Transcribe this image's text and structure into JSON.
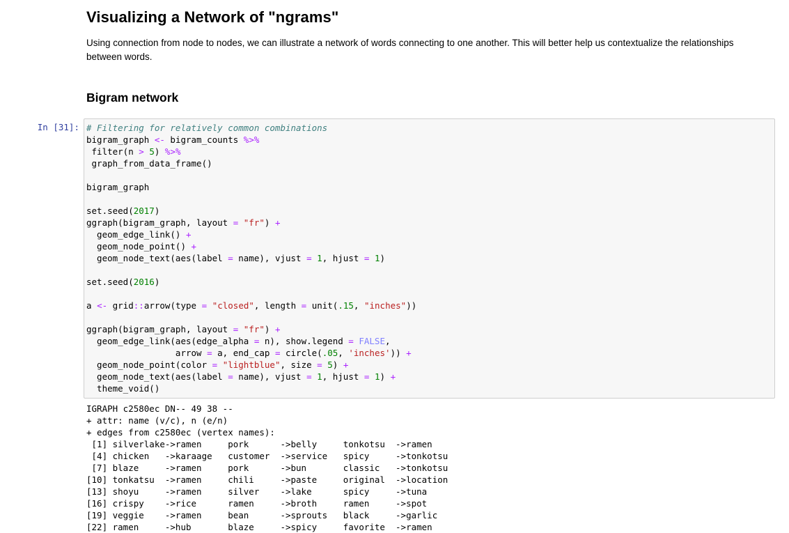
{
  "markdown": {
    "title": "Visualizing a Network of \"ngrams\"",
    "intro": "Using connection from node to nodes, we can illustrate a network of words connecting to one another. This will better help us contextualize the relationships between words.",
    "subtitle": "Bigram network"
  },
  "cell": {
    "prompt": "In [31]:",
    "code": [
      [
        [
          "cm",
          "# Filtering for relatively common combinations"
        ]
      ],
      [
        [
          "t",
          "bigram_graph "
        ],
        [
          "op",
          "<-"
        ],
        [
          "t",
          " bigram_counts "
        ],
        [
          "op",
          "%>%"
        ]
      ],
      [
        [
          "t",
          " filter(n "
        ],
        [
          "op",
          ">"
        ],
        [
          "t",
          " "
        ],
        [
          "nm",
          "5"
        ],
        [
          "t",
          ") "
        ],
        [
          "op",
          "%>%"
        ]
      ],
      [
        [
          "t",
          " graph_from_data_frame()"
        ]
      ],
      [
        [
          "t",
          ""
        ]
      ],
      [
        [
          "t",
          "bigram_graph"
        ]
      ],
      [
        [
          "t",
          ""
        ]
      ],
      [
        [
          "t",
          "set.seed("
        ],
        [
          "nm",
          "2017"
        ],
        [
          "t",
          ")"
        ]
      ],
      [
        [
          "t",
          "ggraph(bigram_graph, layout "
        ],
        [
          "op",
          "="
        ],
        [
          "t",
          " "
        ],
        [
          "st",
          "\"fr\""
        ],
        [
          "t",
          ") "
        ],
        [
          "op",
          "+"
        ]
      ],
      [
        [
          "t",
          "  geom_edge_link() "
        ],
        [
          "op",
          "+"
        ]
      ],
      [
        [
          "t",
          "  geom_node_point() "
        ],
        [
          "op",
          "+"
        ]
      ],
      [
        [
          "t",
          "  geom_node_text(aes(label "
        ],
        [
          "op",
          "="
        ],
        [
          "t",
          " name), vjust "
        ],
        [
          "op",
          "="
        ],
        [
          "t",
          " "
        ],
        [
          "nm",
          "1"
        ],
        [
          "t",
          ", hjust "
        ],
        [
          "op",
          "="
        ],
        [
          "t",
          " "
        ],
        [
          "nm",
          "1"
        ],
        [
          "t",
          ")"
        ]
      ],
      [
        [
          "t",
          ""
        ]
      ],
      [
        [
          "t",
          "set.seed("
        ],
        [
          "nm",
          "2016"
        ],
        [
          "t",
          ")"
        ]
      ],
      [
        [
          "t",
          ""
        ]
      ],
      [
        [
          "t",
          "a "
        ],
        [
          "op",
          "<-"
        ],
        [
          "t",
          " grid"
        ],
        [
          "op",
          "::"
        ],
        [
          "t",
          "arrow(type "
        ],
        [
          "op",
          "="
        ],
        [
          "t",
          " "
        ],
        [
          "st",
          "\"closed\""
        ],
        [
          "t",
          ", length "
        ],
        [
          "op",
          "="
        ],
        [
          "t",
          " unit("
        ],
        [
          "nm",
          ".15"
        ],
        [
          "t",
          ", "
        ],
        [
          "st",
          "\"inches\""
        ],
        [
          "t",
          "))"
        ]
      ],
      [
        [
          "t",
          ""
        ]
      ],
      [
        [
          "t",
          "ggraph(bigram_graph, layout "
        ],
        [
          "op",
          "="
        ],
        [
          "t",
          " "
        ],
        [
          "st",
          "\"fr\""
        ],
        [
          "t",
          ") "
        ],
        [
          "op",
          "+"
        ]
      ],
      [
        [
          "t",
          "  geom_edge_link(aes(edge_alpha "
        ],
        [
          "op",
          "="
        ],
        [
          "t",
          " n), show.legend "
        ],
        [
          "op",
          "="
        ],
        [
          "t",
          " "
        ],
        [
          "kw",
          "FALSE"
        ],
        [
          "t",
          ","
        ]
      ],
      [
        [
          "t",
          "                 arrow "
        ],
        [
          "op",
          "="
        ],
        [
          "t",
          " a, end_cap "
        ],
        [
          "op",
          "="
        ],
        [
          "t",
          " circle("
        ],
        [
          "nm",
          ".05"
        ],
        [
          "t",
          ", "
        ],
        [
          "st",
          "'inches'"
        ],
        [
          "t",
          ")) "
        ],
        [
          "op",
          "+"
        ]
      ],
      [
        [
          "t",
          "  geom_node_point(color "
        ],
        [
          "op",
          "="
        ],
        [
          "t",
          " "
        ],
        [
          "st",
          "\"lightblue\""
        ],
        [
          "t",
          ", size "
        ],
        [
          "op",
          "="
        ],
        [
          "t",
          " "
        ],
        [
          "nm",
          "5"
        ],
        [
          "t",
          ") "
        ],
        [
          "op",
          "+"
        ]
      ],
      [
        [
          "t",
          "  geom_node_text(aes(label "
        ],
        [
          "op",
          "="
        ],
        [
          "t",
          " name), vjust "
        ],
        [
          "op",
          "="
        ],
        [
          "t",
          " "
        ],
        [
          "nm",
          "1"
        ],
        [
          "t",
          ", hjust "
        ],
        [
          "op",
          "="
        ],
        [
          "t",
          " "
        ],
        [
          "nm",
          "1"
        ],
        [
          "t",
          ") "
        ],
        [
          "op",
          "+"
        ]
      ],
      [
        [
          "t",
          "  theme_void()"
        ]
      ]
    ]
  },
  "output": {
    "lines": [
      "IGRAPH c2580ec DN-- 49 38 --",
      "+ attr: name (v/c), n (e/n)",
      "+ edges from c2580ec (vertex names):",
      " [1] silverlake->ramen     pork      ->belly     tonkotsu  ->ramen",
      " [4] chicken   ->karaage   customer  ->service   spicy     ->tonkotsu",
      " [7] blaze     ->ramen     pork      ->bun       classic   ->tonkotsu",
      "[10] tonkatsu  ->ramen     chili     ->paste     original  ->location",
      "[13] shoyu     ->ramen     silver    ->lake      spicy     ->tuna",
      "[16] crispy    ->rice      ramen     ->broth     ramen     ->spot",
      "[19] veggie    ->ramen     bean      ->sprouts   black     ->garlic",
      "[22] ramen     ->hub       blaze     ->spicy     favorite  ->ramen"
    ]
  }
}
